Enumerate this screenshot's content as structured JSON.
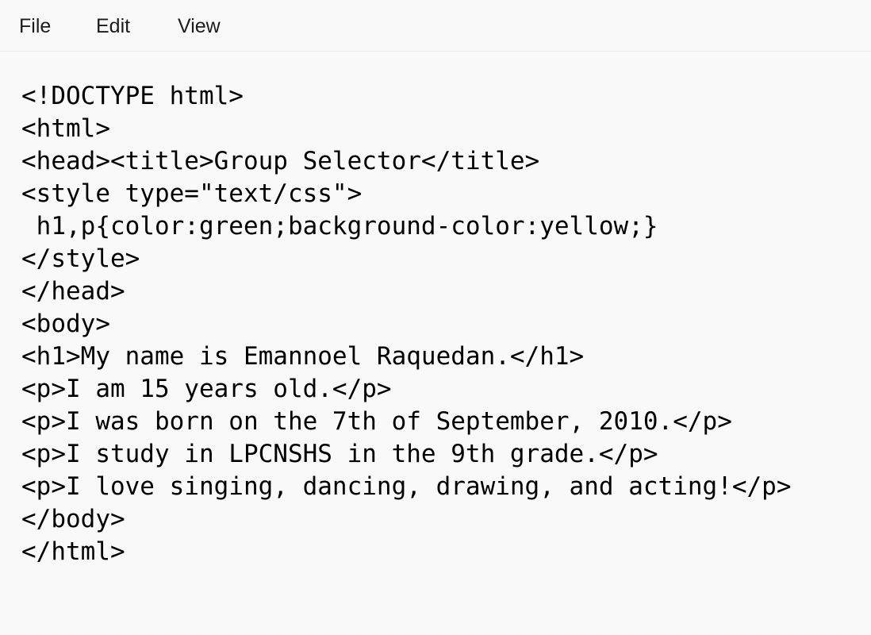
{
  "menubar": {
    "items": [
      {
        "label": "File"
      },
      {
        "label": "Edit"
      },
      {
        "label": "View"
      }
    ]
  },
  "editor": {
    "lines": [
      "<!DOCTYPE html>",
      "<html>",
      "<head><title>Group Selector</title>",
      "<style type=\"text/css\">",
      " h1,p{color:green;background-color:yellow;}",
      "</style>",
      "</head>",
      "<body>",
      "<h1>My name is Emannoel Raquedan.</h1>",
      "<p>I am 15 years old.</p>",
      "<p>I was born on the 7th of September, 2010.</p>",
      "<p>I study in LPCNSHS in the 9th grade.</p>",
      "<p>I love singing, dancing, drawing, and acting!</p>",
      "</body>",
      "</html>"
    ]
  }
}
